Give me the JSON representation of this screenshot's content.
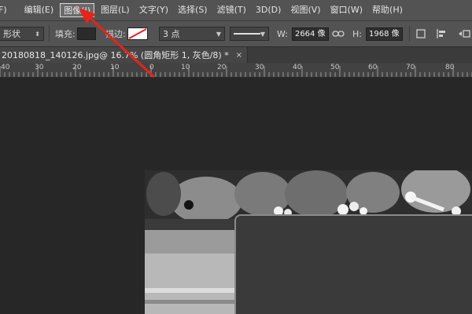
{
  "menu": {
    "items": [
      {
        "label": "F)"
      },
      {
        "label": "编辑(E)"
      },
      {
        "label": "图像(I)"
      },
      {
        "label": "图层(L)"
      },
      {
        "label": "文字(Y)"
      },
      {
        "label": "选择(S)"
      },
      {
        "label": "滤镜(T)"
      },
      {
        "label": "3D(D)"
      },
      {
        "label": "视图(V)"
      },
      {
        "label": "窗口(W)"
      },
      {
        "label": "帮助(H)"
      }
    ],
    "active_index": 2
  },
  "options": {
    "mode_value": "形状",
    "fill_label": "填充:",
    "stroke_label": "描边:",
    "stroke_width_value": "3 点",
    "width_label": "W:",
    "width_value": "2664 像",
    "height_label": "H:",
    "height_value": "1968 像",
    "fill_color": "#2b2b2b",
    "stroke_color": "#ffffff"
  },
  "document": {
    "tab_title": "20180818_140126.jpg@ 16.7% (圆角矩形 1, 灰色/8) *",
    "close_glyph": "×"
  },
  "ruler": {
    "labels": [
      "40",
      "30",
      "20",
      "10",
      "0",
      "10",
      "20",
      "30",
      "40",
      "50",
      "60",
      "70",
      "80"
    ]
  },
  "colors": {
    "annotation_arrow": "#e8231a",
    "ui_panel": "#535353",
    "canvas_bg": "#272727"
  }
}
